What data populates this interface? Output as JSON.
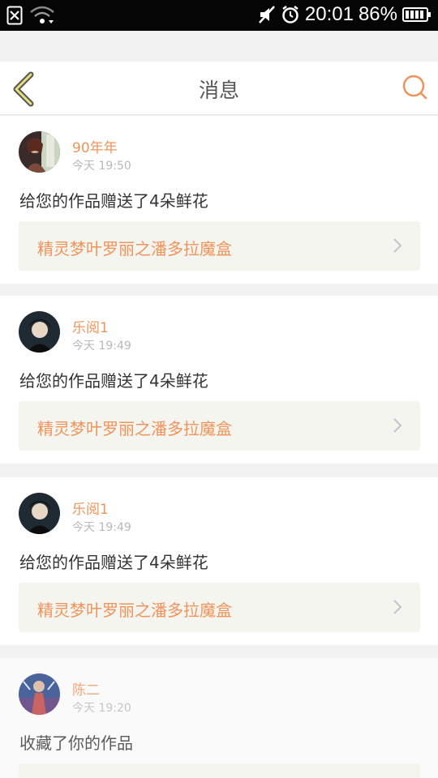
{
  "status_bar": {
    "time": "20:01",
    "battery": "86%",
    "icons": [
      "sim-off-icon",
      "wifi-icon",
      "mute-icon",
      "alarm-icon",
      "battery-icon"
    ]
  },
  "header": {
    "title": "消息",
    "back_icon": "back-chevron-icon",
    "search_icon": "search-icon",
    "accent": "#f0935a"
  },
  "messages": [
    {
      "user": "90年年",
      "time": "今天 19:50",
      "text": "给您的作品赠送了4朵鲜花",
      "work": "精灵梦叶罗丽之潘多拉魔盒"
    },
    {
      "user": "乐阅1",
      "time": "今天 19:49",
      "text": "给您的作品赠送了4朵鲜花",
      "work": "精灵梦叶罗丽之潘多拉魔盒"
    },
    {
      "user": "乐阅1",
      "time": "今天 19:49",
      "text": "给您的作品赠送了4朵鲜花",
      "work": "精灵梦叶罗丽之潘多拉魔盒"
    },
    {
      "user": "陈二",
      "time": "今天 19:20",
      "text": "收藏了你的作品",
      "work": ""
    }
  ]
}
